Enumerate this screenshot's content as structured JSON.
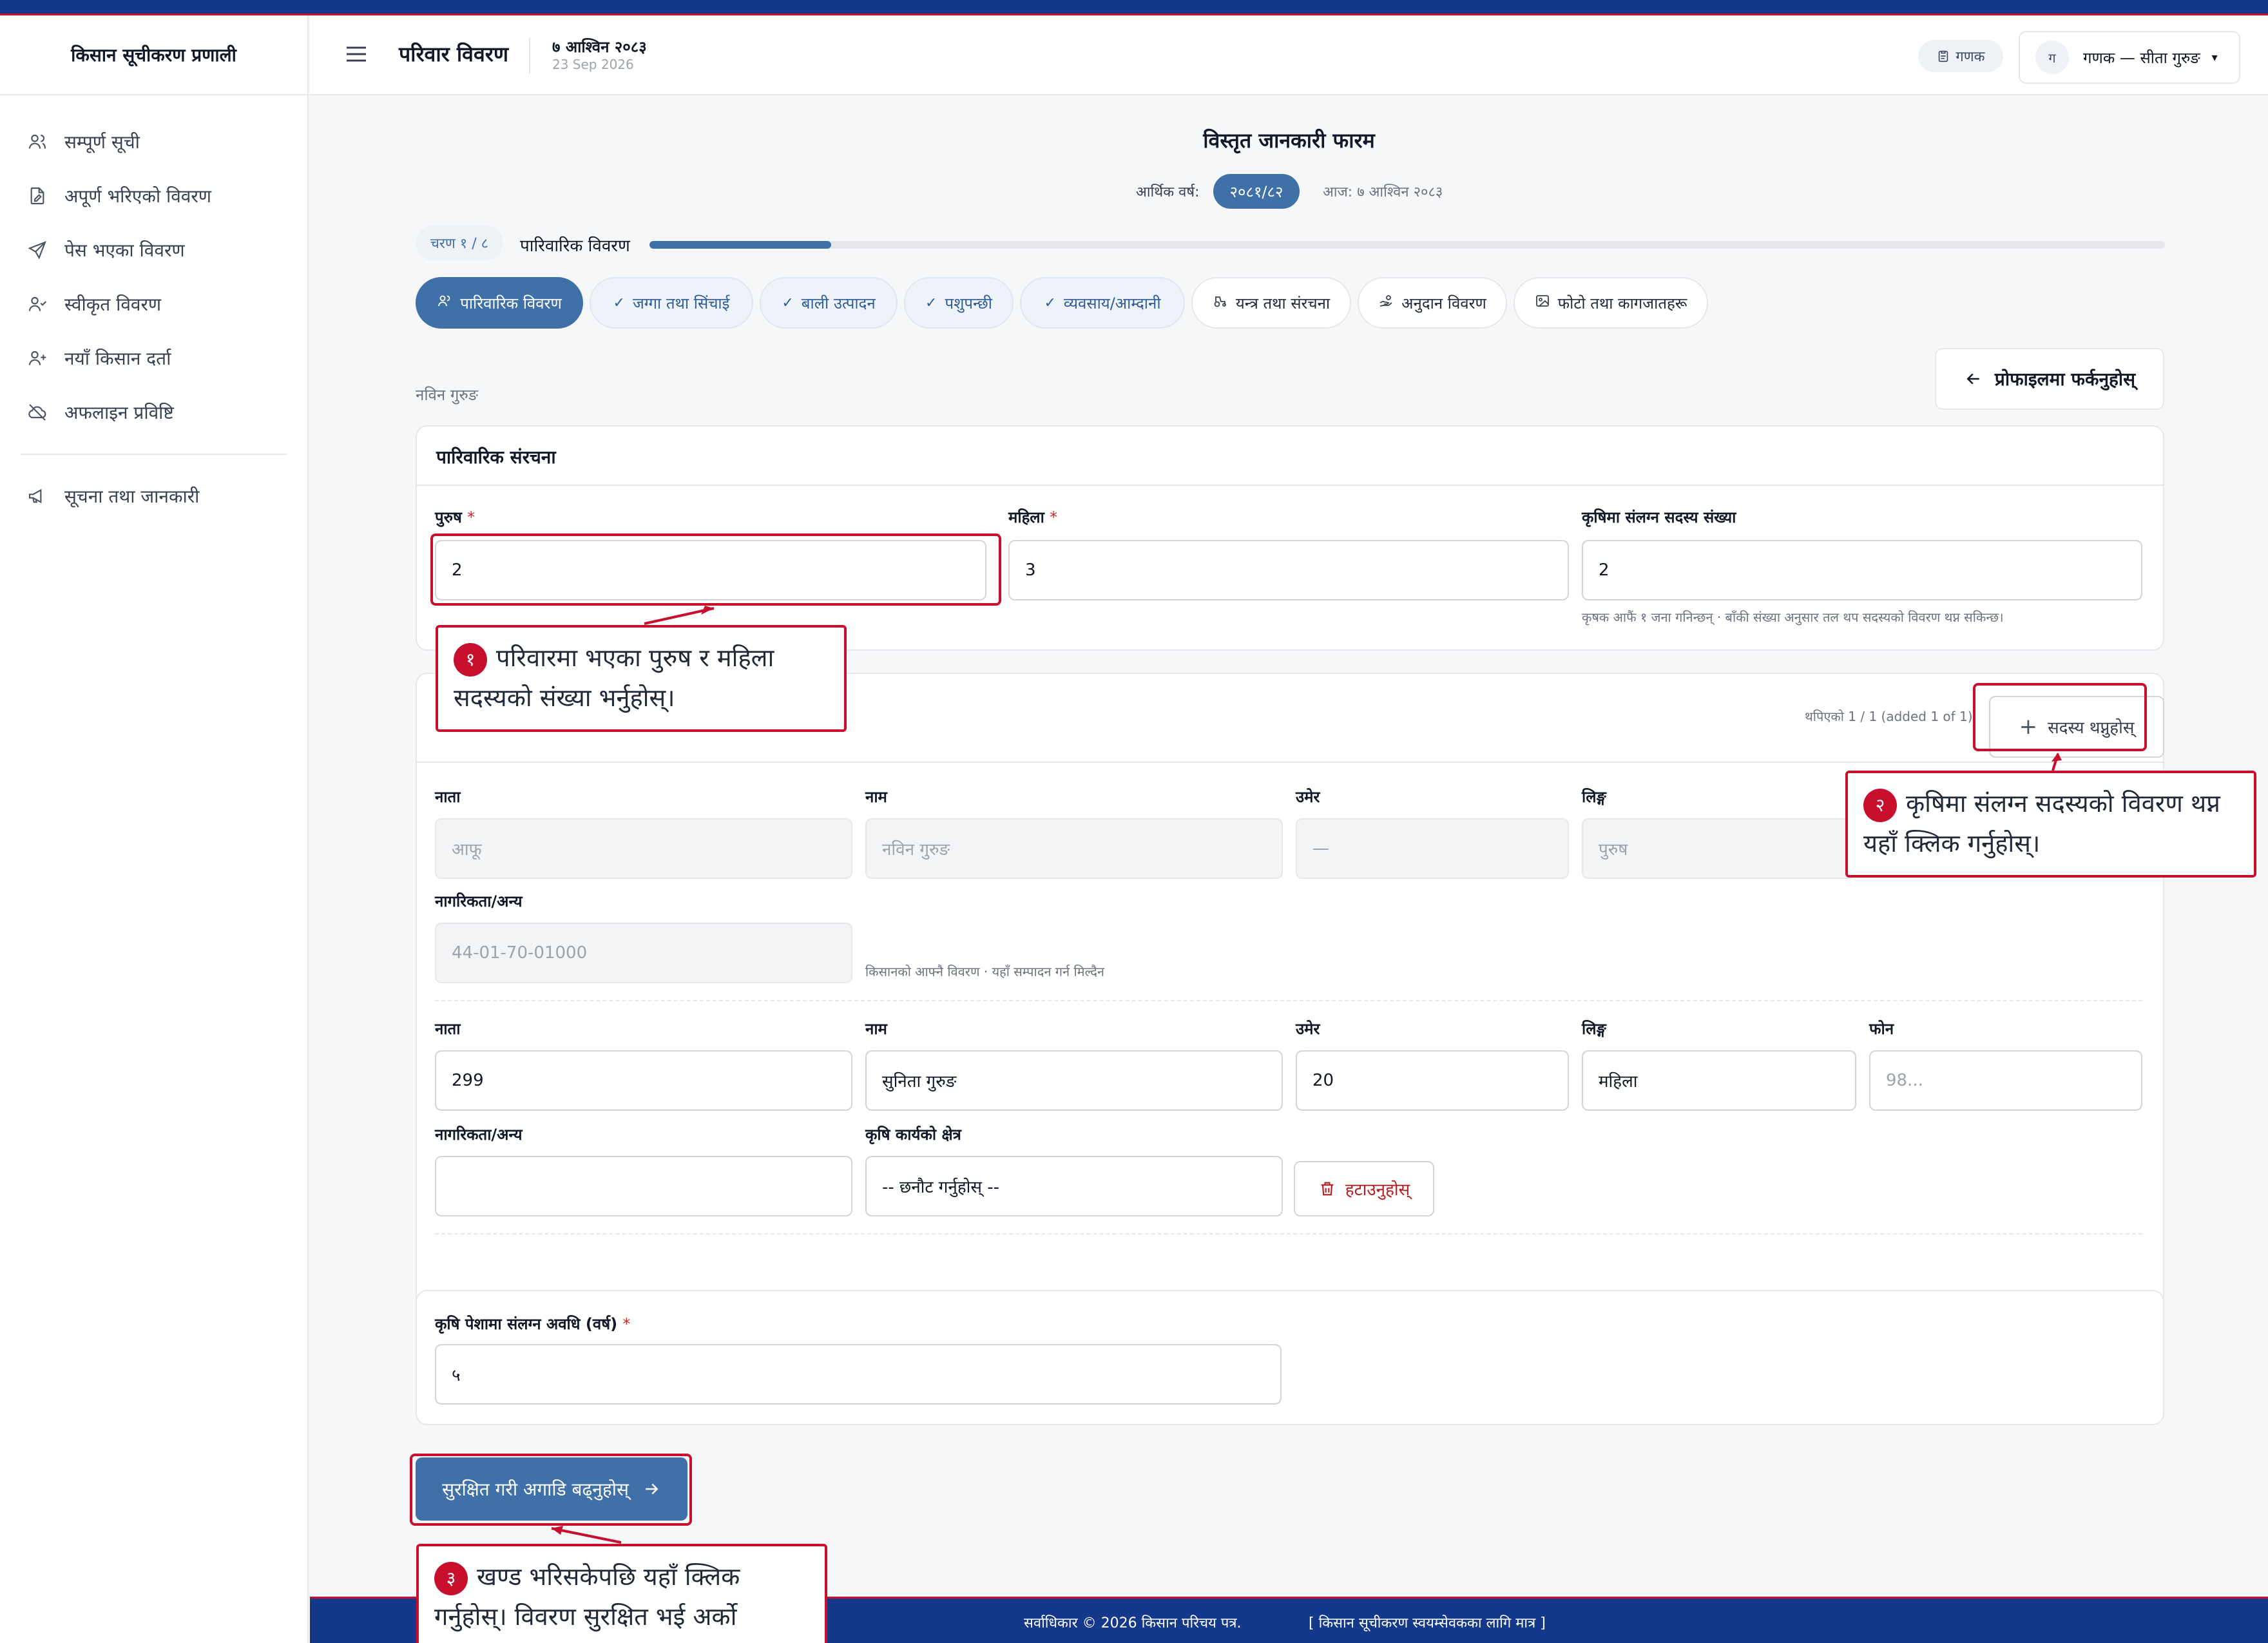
{
  "app": {
    "title": "किसान सूचीकरण प्रणाली"
  },
  "sidebar": {
    "items": [
      {
        "label": "सम्पूर्ण सूची",
        "icon": "users-icon"
      },
      {
        "label": "अपूर्ण भरिएको विवरण",
        "icon": "document-edit-icon"
      },
      {
        "label": "पेस भएका विवरण",
        "icon": "send-icon"
      },
      {
        "label": "स्वीकृत विवरण",
        "icon": "user-check-icon"
      },
      {
        "label": "नयाँ किसान दर्ता",
        "icon": "user-plus-icon"
      },
      {
        "label": "अफलाइन प्रविष्टि",
        "icon": "cloud-off-icon"
      }
    ],
    "extra": {
      "label": "सूचना तथा जानकारी",
      "icon": "megaphone-icon"
    }
  },
  "header": {
    "page_title": "परिवार विवरण",
    "date_np": "७ आश्विन २०८३",
    "date_en": "23 Sep 2026",
    "role": "गणक",
    "avatar": "ग",
    "user": "गणक — सीता गुरुङ"
  },
  "form": {
    "title": "विस्तृत जानकारी फारम",
    "fiscal_year_label": "आर्थिक वर्ष:",
    "fiscal_year": "२०८१/८२",
    "today": "आज: ७ आश्विन २०८३",
    "step": "चरण १ / ८",
    "step_label": "पारिवारिक विवरण",
    "progress": 0.12,
    "tabs": [
      {
        "label": "पारिवारिक विवरण",
        "state": "active",
        "icon": "users-icon"
      },
      {
        "label": "जग्गा तथा सिंचाई",
        "state": "done",
        "icon": "check-icon"
      },
      {
        "label": "बाली उत्पादन",
        "state": "done",
        "icon": "check-icon"
      },
      {
        "label": "पशुपन्छी",
        "state": "done",
        "icon": "check-icon"
      },
      {
        "label": "व्यवसाय/आम्दानी",
        "state": "done",
        "icon": "check-icon"
      },
      {
        "label": "यन्त्र तथा संरचना",
        "state": "todo",
        "icon": "tractor-icon"
      },
      {
        "label": "अनुदान विवरण",
        "state": "todo",
        "icon": "hand-coins-icon"
      },
      {
        "label": "फोटो तथा कागजातहरू",
        "state": "todo",
        "icon": "image-icon"
      }
    ],
    "back_label": "प्रोफाइलमा फर्कनुहोस्",
    "farmer_name": "नविन गुरुङ"
  },
  "family": {
    "heading": "पारिवारिक संरचना",
    "male_label": "पुरुष",
    "male_value": "2",
    "female_label": "महिला",
    "female_value": "3",
    "agri_label": "कृषिमा संलग्न सदस्य संख्या",
    "agri_value": "2",
    "agri_hint": "कृषक आफैं १ जना गनिन्छन् · बाँकी संख्या अनुसार तल थप सदस्यको विवरण थप्न सकिन्छ।"
  },
  "members": {
    "added_text": "थपिएको 1 / 1 (added 1 of 1)",
    "add_label": "सदस्य थप्नुहोस्",
    "labels": {
      "relation": "नाता",
      "name": "नाम",
      "age": "उमेर",
      "gender": "लिङ्ग",
      "phone": "फोन",
      "citizenship": "नागरिकता/अन्य",
      "agri_area": "कृषि कार्यको क्षेत्र"
    },
    "self": {
      "relation": "आफू",
      "name": "नविन गुरुङ",
      "age": "—",
      "gender": "पुरुष",
      "citizenship": "44-01-70-01000",
      "note": "किसानको आफ्नै विवरण · यहाँ सम्पादन गर्न मिल्दैन"
    },
    "member": {
      "relation": "299",
      "name": "सुनिता गुरुङ",
      "age": "20",
      "gender": "महिला",
      "phone_placeholder": "98...",
      "citizenship": "",
      "agri_area": "-- छनौट गर्नुहोस् --",
      "remove_label": "हटाउनुहोस्"
    }
  },
  "duration": {
    "label": "कृषि पेशामा संलग्न अवधि (वर्ष)",
    "value": "५"
  },
  "save_label": "सुरक्षित गरी अगाडि बढ्नुहोस्",
  "callouts": {
    "c1": {
      "num": "१",
      "text": "परिवारमा भएका पुरुष र महिला सदस्यको संख्या भर्नुहोस्।"
    },
    "c2": {
      "num": "२",
      "text": "कृषिमा संलग्न सदस्यको विवरण थप्न यहाँ क्लिक गर्नुहोस्।"
    },
    "c3": {
      "num": "३",
      "text": "खण्ड भरिसकेपछि यहाँ क्लिक गर्नुहोस्। विवरण सुरक्षित भई अर्को खण्डमा"
    }
  },
  "footer": {
    "copyright": "सर्वाधिकार © 2026 किसान परिचय पत्र.",
    "note": "[ किसान सूचीकरण स्वयम्सेवकका लागि मात्र ]"
  },
  "colors": {
    "primary": "#3f70a8",
    "brand_blue": "#14398a",
    "accent_red": "#c8102e"
  }
}
